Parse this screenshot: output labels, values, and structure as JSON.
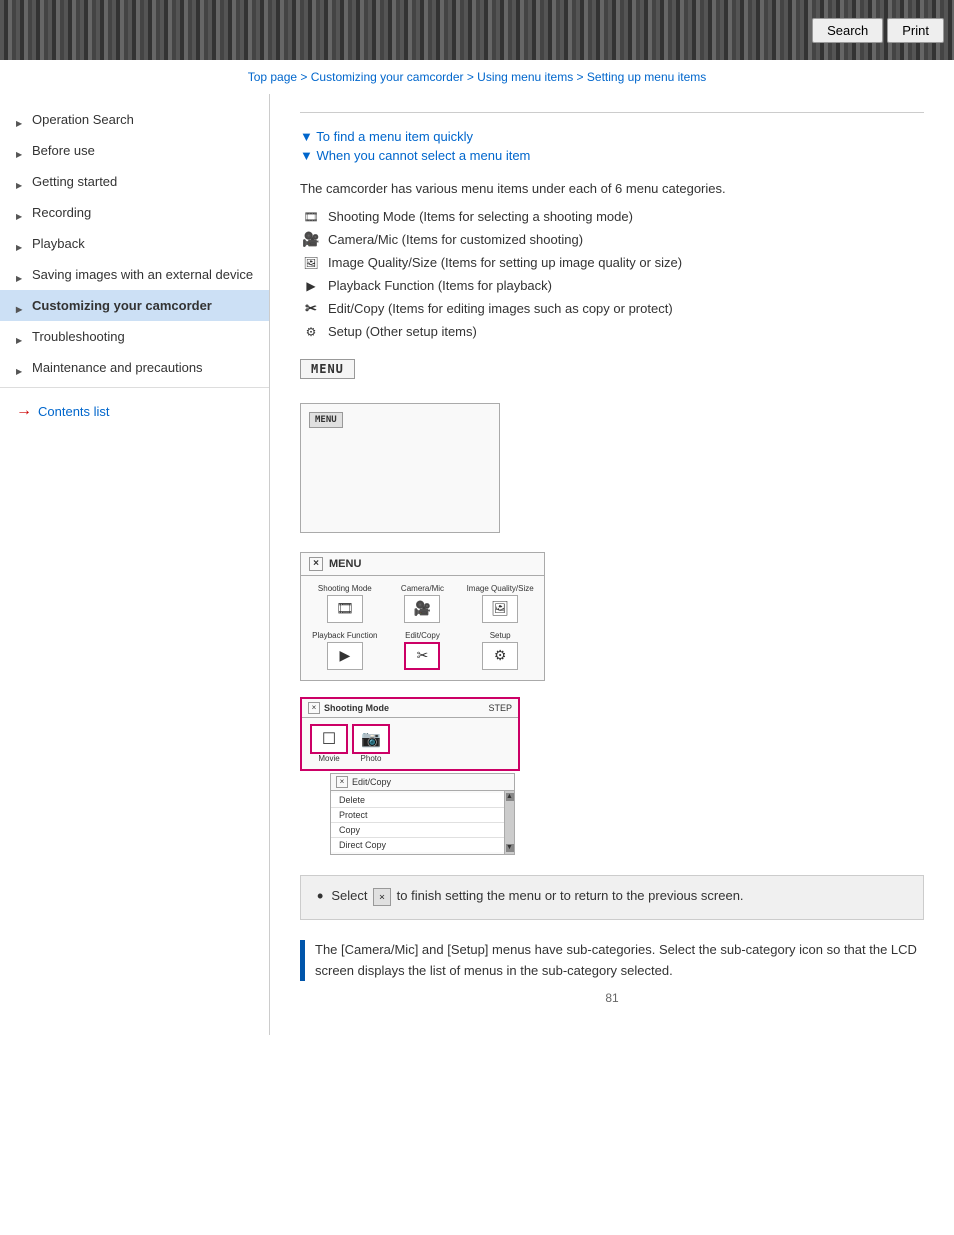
{
  "topbar": {
    "search_label": "Search",
    "print_label": "Print"
  },
  "breadcrumb": {
    "top_page": "Top page",
    "customizing": "Customizing your camcorder",
    "using_menu": "Using menu items",
    "setting_up": "Setting up menu items"
  },
  "sidebar": {
    "items": [
      {
        "id": "operation-search",
        "label": "Operation Search",
        "active": false
      },
      {
        "id": "before-use",
        "label": "Before use",
        "active": false
      },
      {
        "id": "getting-started",
        "label": "Getting started",
        "active": false
      },
      {
        "id": "recording",
        "label": "Recording",
        "active": false
      },
      {
        "id": "playback",
        "label": "Playback",
        "active": false
      },
      {
        "id": "saving-images",
        "label": "Saving images with an external device",
        "active": false
      },
      {
        "id": "customizing",
        "label": "Customizing your camcorder",
        "active": true
      },
      {
        "id": "troubleshooting",
        "label": "Troubleshooting",
        "active": false
      },
      {
        "id": "maintenance",
        "label": "Maintenance and precautions",
        "active": false
      }
    ],
    "contents_list": "Contents list"
  },
  "content": {
    "toc_links": [
      "To find a menu item quickly",
      "When you cannot select a menu item"
    ],
    "intro_text": "The camcorder has various menu items under each of 6 menu categories.",
    "menu_items": [
      {
        "id": "shooting",
        "icon": "🎞",
        "text": "Shooting Mode (Items for selecting a shooting mode)"
      },
      {
        "id": "camera",
        "icon": "🎥",
        "text": "Camera/Mic (Items for customized shooting)"
      },
      {
        "id": "image-quality",
        "icon": "🖼",
        "text": "Image Quality/Size (Items for setting up image quality or size)"
      },
      {
        "id": "playback",
        "icon": "▶",
        "text": "Playback Function (Items for playback)"
      },
      {
        "id": "editcopy",
        "icon": "✂",
        "text": "Edit/Copy (Items for editing images such as copy or protect)"
      },
      {
        "id": "setup",
        "icon": "⚙",
        "text": "Setup (Other setup items)"
      }
    ],
    "menu_button_label": "MENU",
    "diagram1": {
      "menu_btn": "MENU",
      "description": "MENU button display"
    },
    "diagram2": {
      "title": "MENU",
      "close_icon": "×",
      "cells": [
        {
          "label": "Shooting Mode",
          "icon": "🎞"
        },
        {
          "label": "Camera/Mic",
          "icon": "🎥"
        },
        {
          "label": "Image Quality/Size",
          "icon": "🖼"
        },
        {
          "label": "Playback Function",
          "icon": "▶"
        },
        {
          "label": "Edit/Copy",
          "icon": "✂"
        },
        {
          "label": "Setup",
          "icon": "⚙"
        }
      ]
    },
    "diagram3": {
      "top_header_close": "×",
      "top_header_label": "Shooting Mode",
      "top_header_step": "STEP",
      "icon_movie": "☐",
      "icon_movie_label": "Movie",
      "icon_photo": "📷",
      "icon_photo_label": "Photo",
      "bottom_close": "×",
      "bottom_label": "Edit/Copy",
      "list_items": [
        "Delete",
        "Protect",
        "Copy",
        "Direct Copy"
      ]
    },
    "info_box": {
      "bullet": "•",
      "text_start": "Select",
      "x_button": "×",
      "text_end": "to finish setting the menu or to return to the previous screen."
    },
    "note": {
      "text": "The [Camera/Mic] and [Setup] menus have sub-categories. Select the sub-category icon so that the LCD screen displays the list of menus in the sub-category selected."
    },
    "page_number": "81"
  }
}
